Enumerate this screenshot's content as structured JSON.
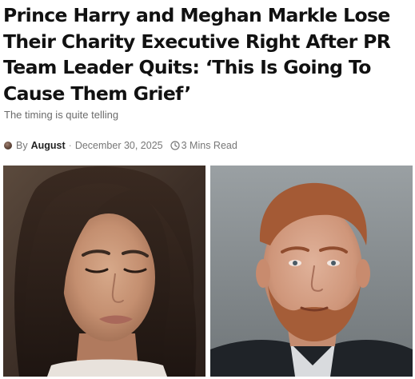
{
  "article": {
    "headline": "Prince Harry and Meghan Markle Lose Their Charity Executive Right After PR Team Leader Quits: ‘This Is Going To Cause Them Grief’",
    "subtitle": "The timing is quite telling",
    "meta": {
      "by_label": "By",
      "author": "August",
      "separator": "·",
      "date": "December 30, 2025",
      "read_time": "3 Mins Read"
    }
  },
  "icons": {
    "author": "author-avatar-icon",
    "clock": "clock-icon"
  },
  "images": {
    "left": "photo-meghan-markle",
    "right": "photo-prince-harry"
  },
  "colors": {
    "headline": "#111111",
    "subtitle": "#6b6b6b",
    "meta": "#777777",
    "author": "#222222"
  }
}
